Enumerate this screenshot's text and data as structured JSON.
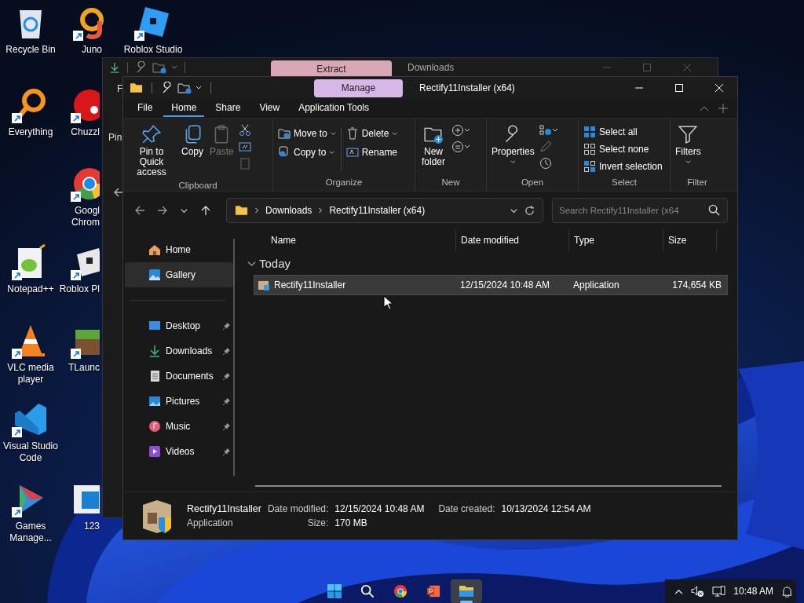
{
  "desktop_icons": [
    {
      "kind": "recycle",
      "shortcut": false,
      "lines": [
        "Recycle Bin"
      ]
    },
    {
      "kind": "juno",
      "shortcut": true,
      "lines": [
        "Juno"
      ]
    },
    {
      "kind": "roblox",
      "shortcut": true,
      "lines": [
        "Roblox Studio"
      ]
    },
    {
      "kind": "everything",
      "shortcut": true,
      "lines": [
        "Everything"
      ]
    },
    {
      "kind": "chuzzle",
      "shortcut": true,
      "lines": [
        "Chuzzl"
      ]
    },
    {
      "kind": "chrome",
      "shortcut": true,
      "lines": [
        "Googl",
        "Chrom"
      ]
    },
    {
      "kind": "notepad",
      "shortcut": true,
      "lines": [
        "Notepad++"
      ]
    },
    {
      "kind": "robloxplayer",
      "shortcut": true,
      "lines": [
        "Roblox Pl"
      ]
    },
    {
      "kind": "vlc",
      "shortcut": true,
      "lines": [
        "VLC media",
        "player"
      ]
    },
    {
      "kind": "minecraft",
      "shortcut": true,
      "lines": [
        "TLaunc"
      ]
    },
    {
      "kind": "vscode",
      "shortcut": true,
      "lines": [
        "Visual Studio",
        "Code"
      ]
    },
    {
      "kind": "games",
      "shortcut": true,
      "lines": [
        "Games",
        "Manage..."
      ]
    },
    {
      "kind": "document",
      "shortcut": false,
      "lines": [
        "123"
      ]
    }
  ],
  "back_window": {
    "context_tab": "Extract",
    "title": "Downloads",
    "menu_letter": "F",
    "ribbon_fragment": "Pin"
  },
  "window": {
    "context_tab": "Manage",
    "title": "Rectify11Installer (x64)",
    "tabs": [
      {
        "label": "File",
        "selected": false
      },
      {
        "label": "Home",
        "selected": true
      },
      {
        "label": "Share",
        "selected": false
      },
      {
        "label": "View",
        "selected": false
      },
      {
        "label": "Application Tools",
        "selected": false
      }
    ],
    "ribbon": {
      "pin": "Pin to Quick access",
      "copy": "Copy",
      "paste": {
        "label": "Paste",
        "disabled": true
      },
      "clipboard": "Clipboard",
      "move_to": "Move to",
      "copy_to": "Copy to",
      "delete": "Delete",
      "rename": "Rename",
      "organize": "Organize",
      "new_folder": "New folder",
      "new": "New",
      "properties": "Properties",
      "open": "Open",
      "select_all": "Select all",
      "select_none": "Select none",
      "invert_selection": "Invert selection",
      "select": "Select",
      "filters": "Filters",
      "filter": "Filter"
    },
    "address": {
      "crumbs": [
        "Downloads",
        "Rectify11Installer (x64)"
      ]
    },
    "search": {
      "placeholder": "Search Rectify11Installer (x64"
    },
    "nav": {
      "top": [
        {
          "kind": "home",
          "label": "Home",
          "selected": false
        },
        {
          "kind": "gallery",
          "label": "Gallery",
          "selected": true
        }
      ],
      "places": [
        {
          "kind": "desktop",
          "label": "Desktop",
          "selected": false,
          "pinned": true
        },
        {
          "kind": "downloads",
          "label": "Downloads",
          "selected": false,
          "pinned": true
        },
        {
          "kind": "documents",
          "label": "Documents",
          "selected": false,
          "pinned": true
        },
        {
          "kind": "pictures",
          "label": "Pictures",
          "selected": false,
          "pinned": true
        },
        {
          "kind": "music",
          "label": "Music",
          "selected": false,
          "pinned": true
        },
        {
          "kind": "videos",
          "label": "Videos",
          "selected": false,
          "pinned": true
        }
      ]
    },
    "columns": [
      "Name",
      "Date modified",
      "Type",
      "Size"
    ],
    "groups": [
      {
        "label": "Today",
        "expanded": true,
        "rows": [
          {
            "name": "Rectify11Installer",
            "date": "12/15/2024 10:48 AM",
            "type": "Application",
            "size": "174,654 KB",
            "selected": true
          }
        ]
      }
    ],
    "details": {
      "name": "Rectify11Installer",
      "type": "Application",
      "fields": [
        {
          "label": "Date modified:",
          "value": "12/15/2024 10:48 AM"
        },
        {
          "label": "Size:",
          "value": "170 MB"
        },
        {
          "label": "Date created:",
          "value": "10/13/2024 12:54 AM"
        }
      ]
    }
  },
  "taskbar": {
    "apps": [
      {
        "kind": "start",
        "active": false
      },
      {
        "kind": "search",
        "active": false
      },
      {
        "kind": "chrome",
        "active": false
      },
      {
        "kind": "powerpoint",
        "active": false
      },
      {
        "kind": "explorer",
        "active": true
      }
    ],
    "time": "10:48 AM"
  }
}
